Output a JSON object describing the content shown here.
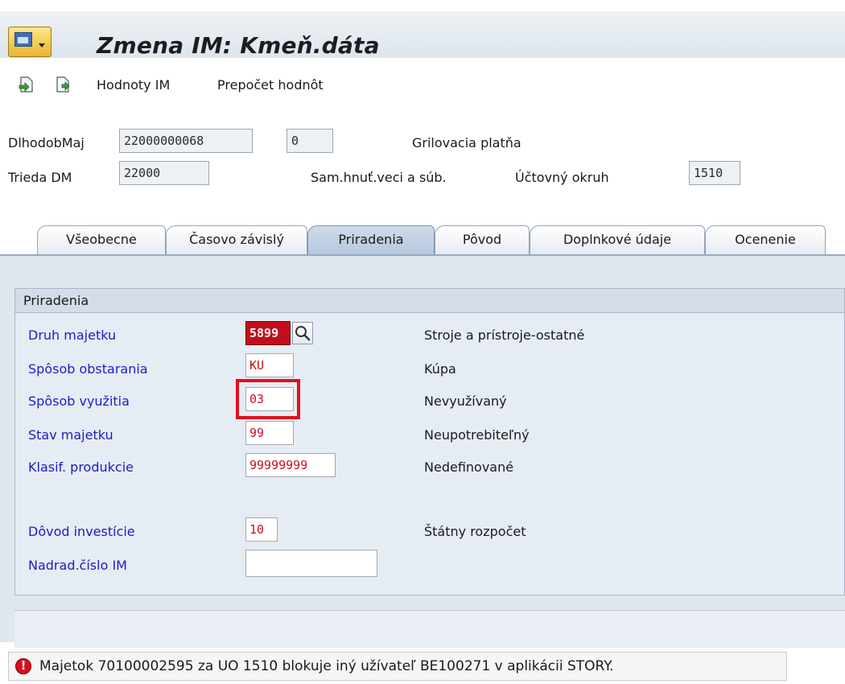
{
  "window": {
    "title": "Zmena IM: Kmeň.dáta"
  },
  "toolbar": {
    "icons": [
      "other-object-icon",
      "display-change-icon"
    ],
    "hodnoty_im": "Hodnoty IM",
    "prepocet_hodnot": "Prepočet hodnôt"
  },
  "header": {
    "dlhodobmaj_label": "DlhodobMaj",
    "dlhodobmaj_value": "22000000068",
    "subnumber_value": "0",
    "description": "Grilovacia platňa",
    "trieda_label": "Trieda DM",
    "trieda_value": "22000",
    "trieda_desc": "Sam.hnuť.veci a súb.",
    "uctovny_okruh_label": "Účtovný okruh",
    "uctovny_okruh_value": "1510"
  },
  "tabs": [
    {
      "label": "Všeobecne",
      "active": false
    },
    {
      "label": "Časovo závislý",
      "active": false
    },
    {
      "label": "Priradenia",
      "active": true
    },
    {
      "label": "Pôvod",
      "active": false
    },
    {
      "label": "Doplnkové údaje",
      "active": false
    },
    {
      "label": "Ocenenie",
      "active": false
    }
  ],
  "group": {
    "title": "Priradenia",
    "fields": [
      {
        "label": "Druh majetku",
        "value": "5899",
        "description": "Stroje a prístroje-ostatné",
        "state": "error"
      },
      {
        "label": "Spôsob obstarania",
        "value": "KU",
        "description": "Kúpa"
      },
      {
        "label": "Spôsob využitia",
        "value": "03",
        "description": "Nevyužívaný",
        "highlighted": true
      },
      {
        "label": "Stav majetku",
        "value": "99",
        "description": "Neupotrebiteľný"
      },
      {
        "label": "Klasif. produkcie",
        "value": "99999999",
        "description": "Nedefinované"
      },
      {
        "label": "Dôvod investície",
        "value": "10",
        "description": "Štátny rozpočet"
      },
      {
        "label": "Nadrad.číslo IM",
        "value": "",
        "description": ""
      }
    ]
  },
  "status": {
    "type": "error",
    "icon": "error-icon",
    "message": "Majetok 70100002595 za UO 1510 blokuje iný užívateľ BE100271 v aplikácii STORY."
  },
  "colors": {
    "field_label": "#1c1cc8",
    "input_text": "#c8101e",
    "error_field_bg": "#c00e1c",
    "highlight_box": "#e0101c"
  }
}
